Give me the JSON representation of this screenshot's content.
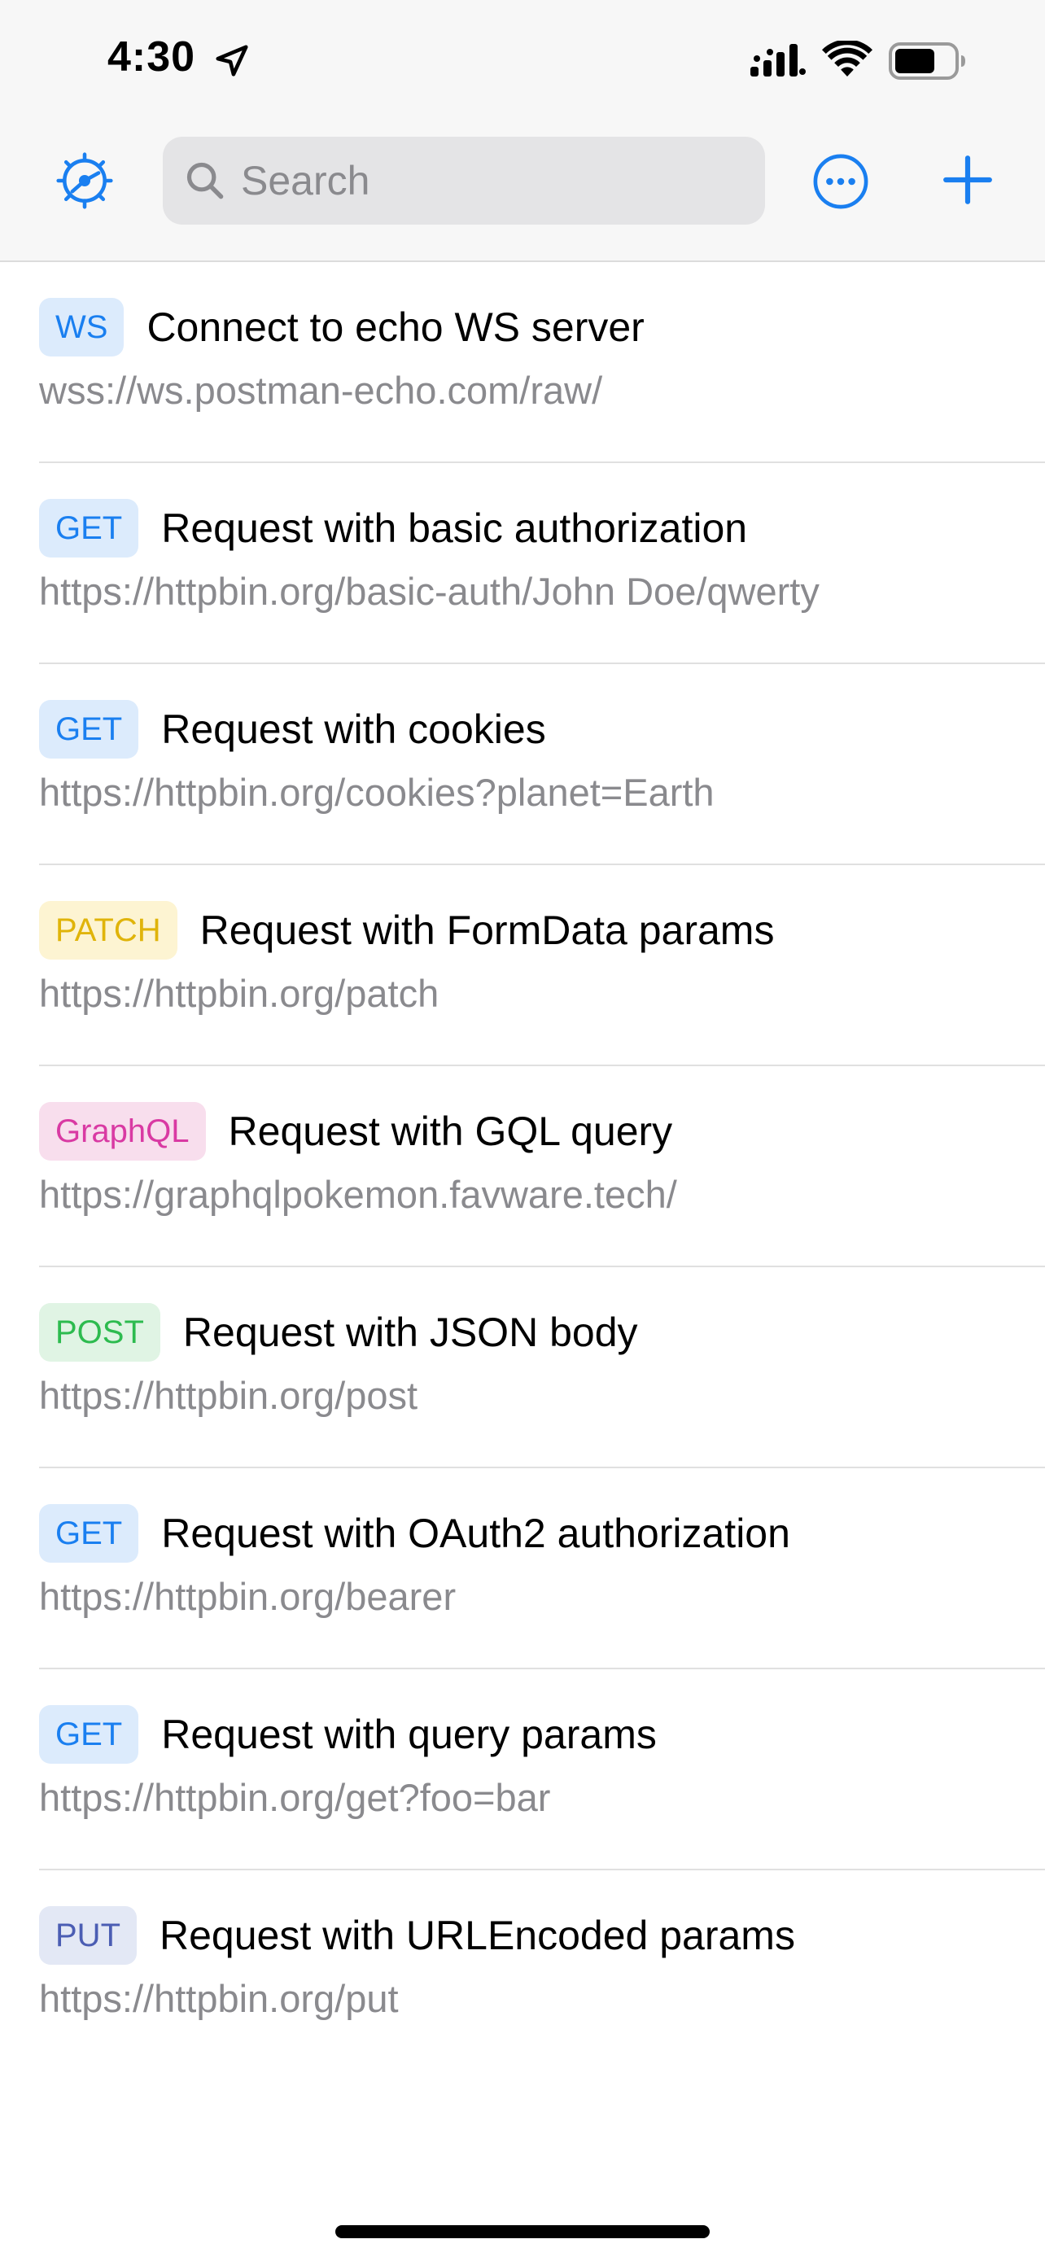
{
  "status_bar": {
    "time": "4:30"
  },
  "toolbar": {
    "search_placeholder": "Search",
    "accent_color": "#1a7ff0"
  },
  "requests": [
    {
      "method": "WS",
      "title": "Connect to echo WS server",
      "url": "wss://ws.postman-echo.com/raw/",
      "badge_bg": "#dcebfc",
      "badge_fg": "#1a7ff0"
    },
    {
      "method": "GET",
      "title": "Request with basic authorization",
      "url": "https://httpbin.org/basic-auth/John Doe/qwerty",
      "badge_bg": "#dcebfc",
      "badge_fg": "#1a7ff0"
    },
    {
      "method": "GET",
      "title": "Request with cookies",
      "url": "https://httpbin.org/cookies?planet=Earth",
      "badge_bg": "#dcebfc",
      "badge_fg": "#1a7ff0"
    },
    {
      "method": "PATCH",
      "title": "Request with FormData params",
      "url": "https://httpbin.org/patch",
      "badge_bg": "#fdf4d2",
      "badge_fg": "#e0b40a"
    },
    {
      "method": "GraphQL",
      "title": "Request with GQL query",
      "url": "https://graphqlpokemon.favware.tech/",
      "badge_bg": "#f8deed",
      "badge_fg": "#d93aa3"
    },
    {
      "method": "POST",
      "title": "Request with JSON body",
      "url": "https://httpbin.org/post",
      "badge_bg": "#e0f4e4",
      "badge_fg": "#2dbb4f"
    },
    {
      "method": "GET",
      "title": "Request with OAuth2 authorization",
      "url": "https://httpbin.org/bearer",
      "badge_bg": "#dcebfc",
      "badge_fg": "#1a7ff0"
    },
    {
      "method": "GET",
      "title": "Request with query params",
      "url": "https://httpbin.org/get?foo=bar",
      "badge_bg": "#dcebfc",
      "badge_fg": "#1a7ff0"
    },
    {
      "method": "PUT",
      "title": "Request with URLEncoded params",
      "url": "https://httpbin.org/put",
      "badge_bg": "#e3e8f5",
      "badge_fg": "#4b5db3"
    }
  ]
}
